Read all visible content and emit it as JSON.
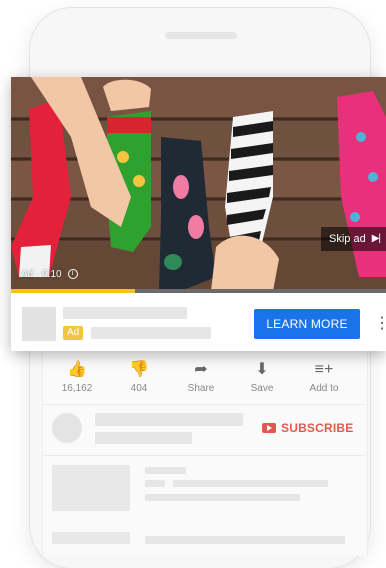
{
  "ad": {
    "time_label": "Ad · 0:10",
    "info_glyph": "i",
    "skip_label": "Skip ad",
    "skip_icon": "▶|",
    "progress": 0.33,
    "badge": "Ad",
    "cta_label": "LEARN MORE",
    "more_glyph": "⋮"
  },
  "actions": [
    {
      "icon": "thumbs-up-icon",
      "glyph": "👍",
      "label": "16,162"
    },
    {
      "icon": "thumbs-down-icon",
      "glyph": "👎",
      "label": "404"
    },
    {
      "icon": "share-icon",
      "glyph": "➦",
      "label": "Share"
    },
    {
      "icon": "download-icon",
      "glyph": "⬇",
      "label": "Save"
    },
    {
      "icon": "add-to-playlist-icon",
      "glyph": "≡+",
      "label": "Add to"
    }
  ],
  "channel": {
    "subscribe_label": "SUBSCRIBE"
  },
  "colors": {
    "cta": "#1a73e8",
    "progress": "#f7c21a",
    "subscribe": "#e05a4f",
    "badge": "#f4c542"
  }
}
